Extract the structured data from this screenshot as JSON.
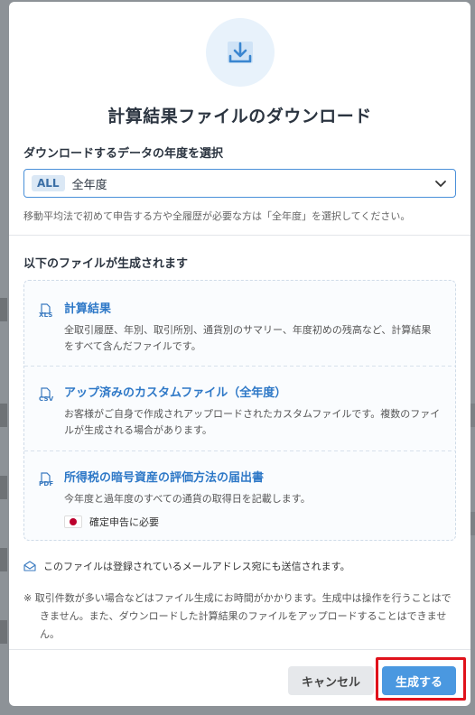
{
  "dialog": {
    "title": "計算結果ファイルのダウンロード",
    "year_select_label": "ダウンロードするデータの年度を選択",
    "year_select": {
      "tag": "ALL",
      "value": "全年度"
    },
    "year_hint": "移動平均法で初めて申告する方や全履歴が必要な方は「全年度」を選択してください。",
    "generated_files_label": "以下のファイルが生成されます",
    "files": [
      {
        "type": "XLS",
        "title": "計算結果",
        "description": "全取引履歴、年別、取引所別、通貨別のサマリー、年度初めの残高など、計算結果をすべて含んだファイルです。"
      },
      {
        "type": "CSV",
        "title": "アップ済みのカスタムファイル（全年度）",
        "description": "お客様がご自身で作成されアップロードされたカスタムファイルです。複数のファイルが生成される場合があります。"
      },
      {
        "type": "PDF",
        "title": "所得税の暗号資産の評価方法の届出書",
        "description": "今年度と過年度のすべての通貨の取得日を記載します。",
        "badge": "確定申告に必要"
      }
    ],
    "mail_note": "このファイルは登録されているメールアドレス宛にも送信されます。",
    "warning_note": "※ 取引件数が多い場合などはファイル生成にお時間がかかります。生成中は操作を行うことはできません。また、ダウンロードした計算結果のファイルをアップロードすることはできません。",
    "buttons": {
      "cancel": "キャンセル",
      "generate": "生成する"
    }
  },
  "colors": {
    "accent": "#4a98e0",
    "link": "#2e78c7",
    "highlight_border": "#e0121b",
    "flag_red": "#bc002d"
  },
  "icons": [
    "download-icon",
    "chevron-down-icon",
    "xls-file-icon",
    "csv-file-icon",
    "pdf-file-icon",
    "japan-flag-icon",
    "mail-icon"
  ]
}
